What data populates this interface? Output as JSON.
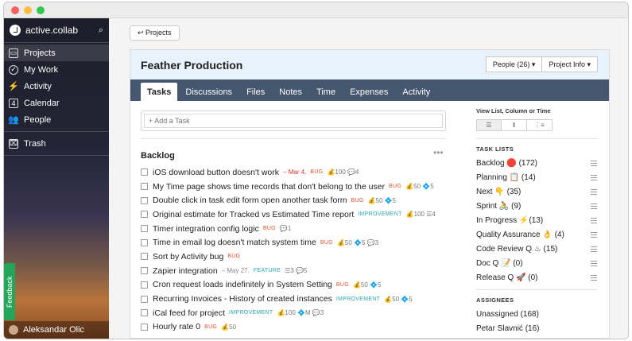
{
  "window": {
    "traffic_lights": [
      "#fc605c",
      "#fdbc40",
      "#34c84a"
    ]
  },
  "sidebar": {
    "brand": "active.collab",
    "search_icon": "search-icon",
    "items": [
      {
        "label": "Projects",
        "icon": "folder-icon",
        "active": true
      },
      {
        "label": "My Work",
        "icon": "check-circle-icon",
        "active": false
      },
      {
        "label": "Activity",
        "icon": "activity-icon",
        "active": false
      },
      {
        "label": "Calendar",
        "icon": "calendar-icon",
        "active": false
      },
      {
        "label": "People",
        "icon": "people-icon",
        "active": false
      }
    ],
    "trash": "Trash",
    "feedback": "Feedback",
    "user": "Aleksandar Olic"
  },
  "back_button": "↩ Projects",
  "project": {
    "title": "Feather Production",
    "people_btn": "People (26) ▾",
    "info_btn": "Project Info ▾"
  },
  "tabs": [
    "Tasks",
    "Discussions",
    "Files",
    "Notes",
    "Time",
    "Expenses",
    "Activity"
  ],
  "add_task_placeholder": "+ Add a Task",
  "backlog": {
    "title": "Backlog",
    "more": "•••"
  },
  "tasks": [
    {
      "title": "iOS download button doesn't work",
      "due": "– Mar 4.",
      "label": "BUG",
      "meta": "💰100 💬4"
    },
    {
      "title": "My Time page shows time records that don't belong to the user",
      "label": "BUG",
      "meta": "💰50 💠5"
    },
    {
      "title": "Double click in task edit form open another task form",
      "label": "BUG",
      "meta": "💰50 💠5"
    },
    {
      "title": "Original estimate for Tracked vs Estimated Time report",
      "label": "IMPROVEMENT",
      "meta": "💰100 ☰4"
    },
    {
      "title": "Timer integration config logic",
      "label": "BUG",
      "meta": "💬1"
    },
    {
      "title": "Time in email log doesn't match system time",
      "label": "BUG",
      "meta": "💰50 💠5 💬3"
    },
    {
      "title": "Sort by Activity bug",
      "label": "BUG",
      "meta": ""
    },
    {
      "title": "Zapier integration",
      "due": "– May 27.",
      "label": "FEATURE",
      "meta": "☰3 💬5"
    },
    {
      "title": "Cron request loads indefinitely in System Setting",
      "label": "BUG",
      "meta": "💰50 💠5"
    },
    {
      "title": "Recurring Invoices - History of created instances",
      "label": "IMPROVEMENT",
      "meta": "💰50 💠5"
    },
    {
      "title": "iCal feed for project",
      "label": "IMPROVEMENT",
      "meta": "💰100 💠M 💬3"
    },
    {
      "title": "Hourly rate 0",
      "label": "BUG",
      "meta": "💰50"
    }
  ],
  "view_switch": {
    "caption": "View List, Column or Time",
    "buttons": [
      "☰",
      "⦀",
      "⋮≡"
    ]
  },
  "task_lists": {
    "heading": "TASK LISTS",
    "items": [
      "Backlog 🛑 (172)",
      "Planning 📋 (14)",
      "Next 👇 (35)",
      "Sprint 🚴 (9)",
      "In Progress ⚡(13)",
      "Quality Assurance 👌 (4)",
      "Code Review Q ♨ (15)",
      "Doc Q 📝 (0)",
      "Release Q 🚀 (0)"
    ]
  },
  "assignees": {
    "heading": "ASSIGNEES",
    "items": [
      "Unassigned (168)",
      "Petar Slavnić (16)"
    ]
  }
}
